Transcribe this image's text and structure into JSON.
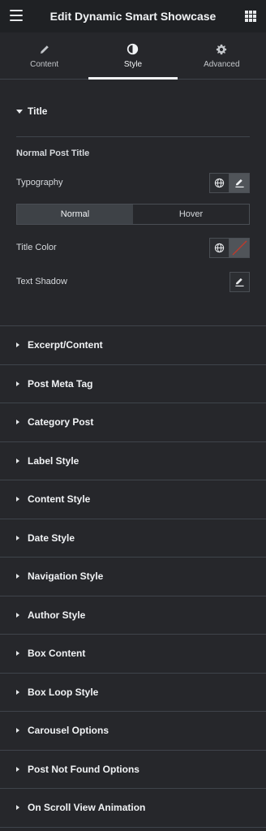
{
  "header": {
    "title": "Edit Dynamic Smart Showcase"
  },
  "tabs": [
    {
      "label": "Content",
      "icon": "pencil-icon"
    },
    {
      "label": "Style",
      "icon": "half-circle-icon"
    },
    {
      "label": "Advanced",
      "icon": "gear-icon"
    }
  ],
  "active_tab": "Style",
  "title_section": {
    "label": "Title",
    "subheading": "Normal Post Title",
    "typography_label": "Typography",
    "state_tabs": [
      "Normal",
      "Hover"
    ],
    "active_state": "Normal",
    "title_color_label": "Title Color",
    "text_shadow_label": "Text Shadow"
  },
  "collapsed_sections": [
    "Excerpt/Content",
    "Post Meta Tag",
    "Category Post",
    "Label Style",
    "Content Style",
    "Date Style",
    "Navigation Style",
    "Author Style",
    "Box Content",
    "Box Loop Style",
    "Carousel Options",
    "Post Not Found Options",
    "On Scroll View Animation"
  ],
  "colors": {
    "panel_bg": "#26272b",
    "topbar_bg": "#1f2124",
    "border": "#3f444b",
    "clear_color_slash": "#c0392b"
  }
}
